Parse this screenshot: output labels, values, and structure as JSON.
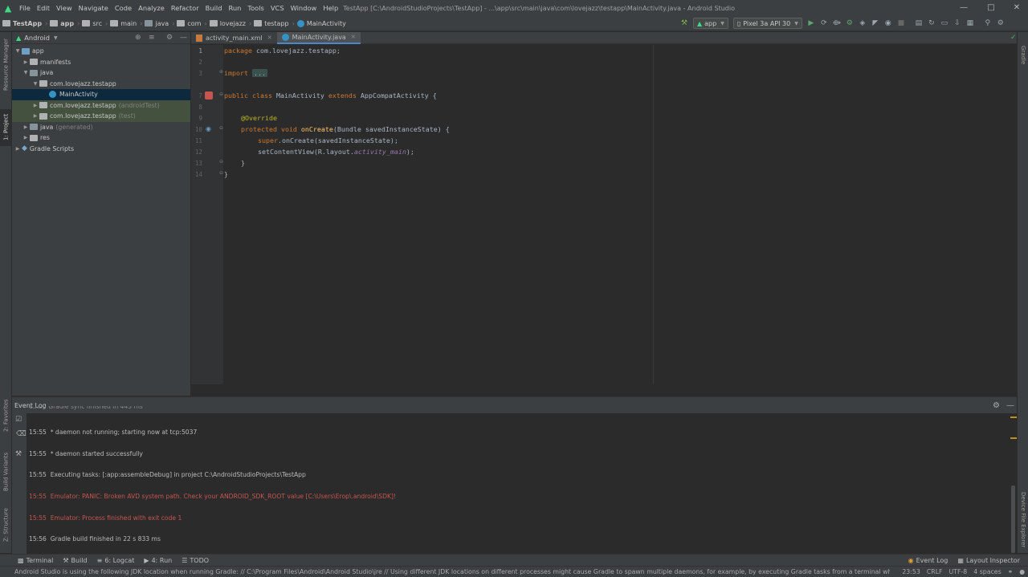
{
  "menu": {
    "items": [
      "File",
      "Edit",
      "View",
      "Navigate",
      "Code",
      "Analyze",
      "Refactor",
      "Build",
      "Run",
      "Tools",
      "VCS",
      "Window",
      "Help"
    ],
    "title": "TestApp [C:\\AndroidStudioProjects\\TestApp] - ...\\app\\src\\main\\java\\com\\lovejazz\\testapp\\MainActivity.java - Android Studio"
  },
  "breadcrumb": [
    "TestApp",
    "app",
    "src",
    "main",
    "java",
    "com",
    "lovejazz",
    "testapp",
    "MainActivity"
  ],
  "toolbar": {
    "run_config": "app",
    "device": "Pixel 3a API 30"
  },
  "left_strip": {
    "resource_manager": "Resource Manager",
    "project": "1: Project",
    "favorites": "2: Favorites",
    "build_variants": "Build Variants",
    "structure": "Z: Structure"
  },
  "right_strip": {
    "gradle": "Gradle",
    "device_file_explorer": "Device File Explorer"
  },
  "project": {
    "view": "Android",
    "tree": [
      {
        "label": "app",
        "suffix": "",
        "level": 0
      },
      {
        "label": "manifests",
        "suffix": "",
        "level": 1
      },
      {
        "label": "java",
        "suffix": "",
        "level": 1
      },
      {
        "label": "com.lovejazz.testapp",
        "suffix": "",
        "level": 2
      },
      {
        "label": "MainActivity",
        "suffix": "",
        "level": 3
      },
      {
        "label": "com.lovejazz.testapp",
        "suffix": "(androidTest)",
        "level": 2
      },
      {
        "label": "com.lovejazz.testapp",
        "suffix": "(test)",
        "level": 2
      },
      {
        "label": "java",
        "suffix": "(generated)",
        "level": 1
      },
      {
        "label": "res",
        "suffix": "",
        "level": 1
      },
      {
        "label": "Gradle Scripts",
        "suffix": "",
        "level": 0
      }
    ]
  },
  "tabs": [
    {
      "label": "activity_main.xml"
    },
    {
      "label": "MainActivity.java"
    }
  ],
  "code": {
    "line_numbers": [
      "1",
      "2",
      "3",
      "",
      "7",
      "8",
      "9",
      "10",
      "11",
      "12",
      "13",
      "14"
    ],
    "package_kw": "package",
    "package_name": " com.lovejazz.testapp;",
    "import_kw": "import",
    "import_folded": "...",
    "class_kw": "public class",
    "class_name": " MainActivity ",
    "extends_kw": "extends",
    "super_class": " AppCompatActivity {",
    "annotation": "@Override",
    "method_kw": "protected void",
    "method_name": " onCreate",
    "method_params": "(Bundle savedInstanceState) {",
    "super_kw": "super",
    "super_call": ".onCreate(savedInstanceState);",
    "set_content": "setContentView(R.layout.",
    "layout_ref": "activity_main",
    "set_content_end": ");",
    "close_method": "}",
    "close_class": "}"
  },
  "event_log": {
    "title": "Event Log",
    "partial": "15:55  Gradle sync finished in 443 ms",
    "lines": [
      {
        "time": "15:55",
        "text": "* daemon not running; starting now at tcp:5037",
        "error": false
      },
      {
        "time": "15:55",
        "text": "* daemon started successfully",
        "error": false
      },
      {
        "time": "15:55",
        "text": "Executing tasks: [:app:assembleDebug] in project C:\\AndroidStudioProjects\\TestApp",
        "error": false
      },
      {
        "time": "15:55",
        "text": "Emulator: PANIC: Broken AVD system path. Check your ANDROID_SDK_ROOT value [C:\\Users\\Erop\\.android\\SDK]!",
        "error": true
      },
      {
        "time": "15:55",
        "text": "Emulator: Process finished with exit code 1",
        "error": true
      },
      {
        "time": "15:56",
        "text": "Gradle build finished in 22 s 833 ms",
        "error": false
      }
    ]
  },
  "bottom_tabs": {
    "terminal": "Terminal",
    "build": "Build",
    "logcat": "6: Logcat",
    "run": "4: Run",
    "todo": "TODO",
    "event_log": "Event Log",
    "layout_inspector": "Layout Inspector"
  },
  "status": {
    "message": "Android Studio is using the following JDK location when running Gradle: // C:\\Program Files\\Android\\Android Studio\\jre // Using different JDK locations on different processes might cause Gradle to spawn multiple daemons, for example, by executing Gradle tasks from a terminal while us... (3 minutes ago)",
    "position": "23:53",
    "line_sep": "CRLF",
    "encoding": "UTF-8",
    "indent": "4 spaces"
  },
  "colors": {
    "background": "#2b2b2b",
    "panel": "#3c3f41",
    "keyword": "#cc7832",
    "error": "#c75450",
    "accent": "#4a88c7"
  }
}
